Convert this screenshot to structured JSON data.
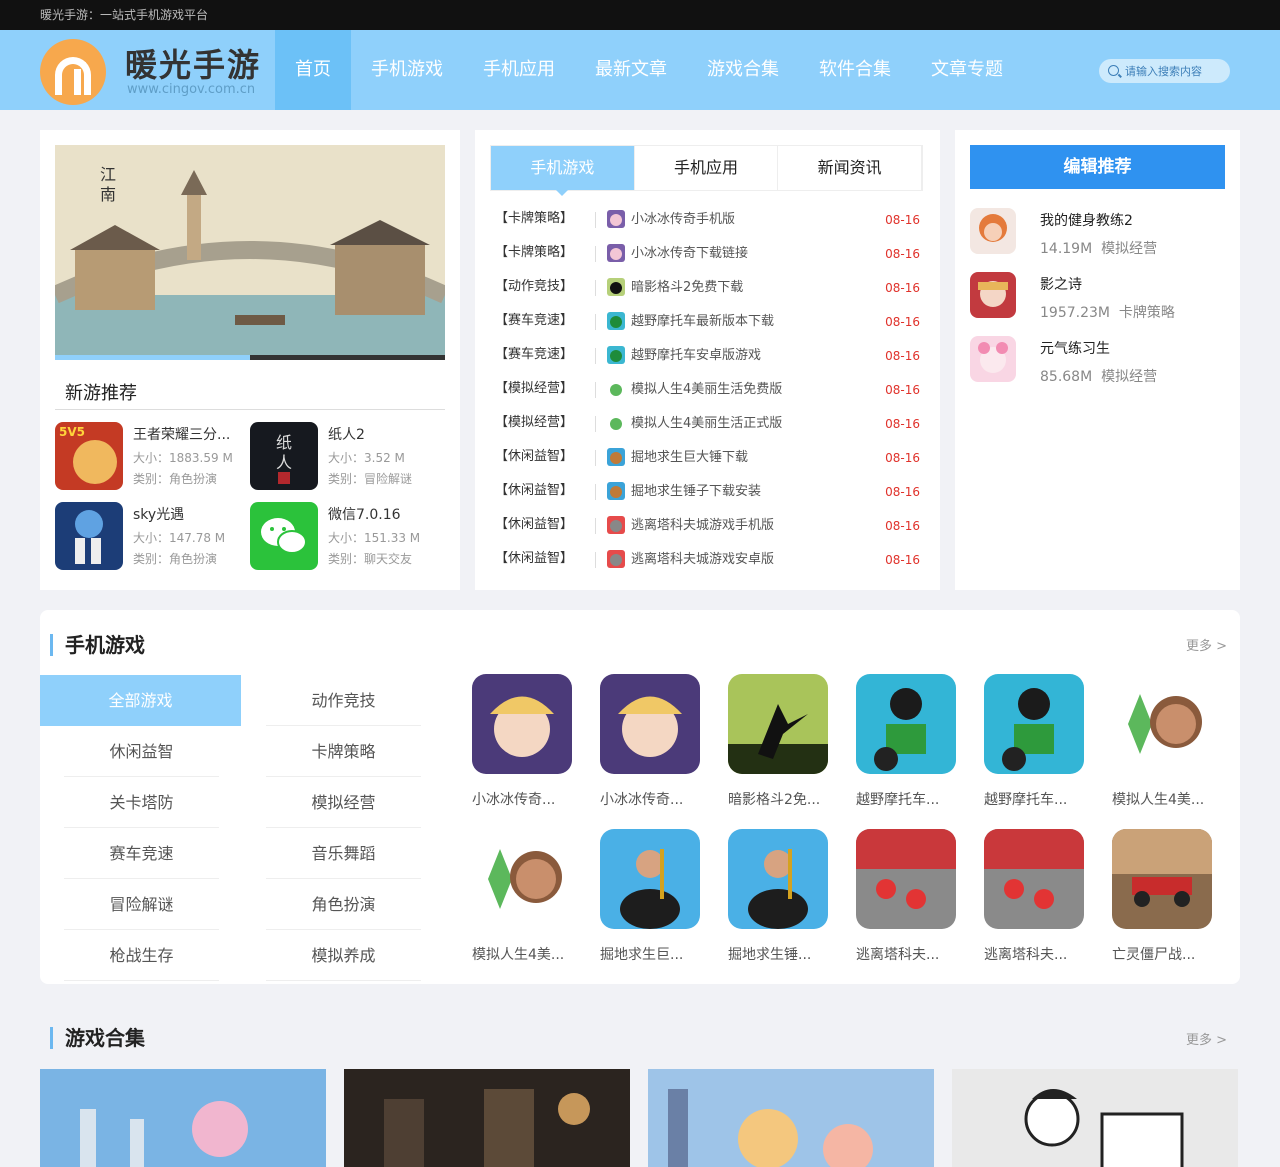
{
  "topbar": {
    "text": "暖光手游：一站式手机游戏平台"
  },
  "header": {
    "logo_title": "暖光手游",
    "logo_sub": "www.cingov.com.cn",
    "nav": [
      "首页",
      "手机游戏",
      "手机应用",
      "最新文章",
      "游戏合集",
      "软件合集",
      "文章专题"
    ],
    "search_placeholder": "请输入搜索内容"
  },
  "left_panel": {
    "banner_progress": 0.5,
    "section_title": "新游推荐",
    "items": [
      {
        "name": "王者荣耀三分...",
        "size": "大小：1883.59 M",
        "cat": "类别：角色扮演"
      },
      {
        "name": "纸人2",
        "size": "大小：3.52 M",
        "cat": "类别：冒险解谜"
      },
      {
        "name": "sky光遇",
        "size": "大小：147.78 M",
        "cat": "类别：角色扮演"
      },
      {
        "name": "微信7.0.16",
        "size": "大小：151.33 M",
        "cat": "类别：聊天交友"
      }
    ]
  },
  "middle_panel": {
    "tabs": [
      "手机游戏",
      "手机应用",
      "新闻资讯"
    ],
    "news": [
      {
        "cat": "【卡牌策略】",
        "title": "小冰冰传奇手机版",
        "date": "08-16"
      },
      {
        "cat": "【卡牌策略】",
        "title": "小冰冰传奇下载链接",
        "date": "08-16"
      },
      {
        "cat": "【动作竞技】",
        "title": "暗影格斗2免费下载",
        "date": "08-16"
      },
      {
        "cat": "【赛车竞速】",
        "title": "越野摩托车最新版本下载",
        "date": "08-16"
      },
      {
        "cat": "【赛车竞速】",
        "title": "越野摩托车安卓版游戏",
        "date": "08-16"
      },
      {
        "cat": "【模拟经营】",
        "title": "模拟人生4美丽生活免费版",
        "date": "08-16"
      },
      {
        "cat": "【模拟经营】",
        "title": "模拟人生4美丽生活正式版",
        "date": "08-16"
      },
      {
        "cat": "【休闲益智】",
        "title": "掘地求生巨大锤下载",
        "date": "08-16"
      },
      {
        "cat": "【休闲益智】",
        "title": "掘地求生锤子下载安装",
        "date": "08-16"
      },
      {
        "cat": "【休闲益智】",
        "title": "逃离塔科夫城游戏手机版",
        "date": "08-16"
      },
      {
        "cat": "【休闲益智】",
        "title": "逃离塔科夫城游戏安卓版",
        "date": "08-16"
      }
    ]
  },
  "editor_panel": {
    "title": "编辑推荐",
    "items": [
      {
        "name": "我的健身教练2",
        "size": "14.19M",
        "cat": "模拟经营"
      },
      {
        "name": "影之诗",
        "size": "1957.23M",
        "cat": "卡牌策略"
      },
      {
        "name": "元气练习生",
        "size": "85.68M",
        "cat": "模拟经营"
      }
    ]
  },
  "mobile_games": {
    "title": "手机游戏",
    "more": "更多 >",
    "categories_left": [
      "全部游戏",
      "休闲益智",
      "关卡塔防",
      "赛车竞速",
      "冒险解谜",
      "枪战生存"
    ],
    "categories_right": [
      "动作竞技",
      "卡牌策略",
      "模拟经营",
      "音乐舞蹈",
      "角色扮演",
      "模拟养成"
    ],
    "games": [
      "小冰冰传奇...",
      "小冰冰传奇...",
      "暗影格斗2免...",
      "越野摩托车...",
      "越野摩托车...",
      "模拟人生4美...",
      "模拟人生4美...",
      "掘地求生巨...",
      "掘地求生锤...",
      "逃离塔科夫...",
      "逃离塔科夫...",
      "亡灵僵尸战..."
    ]
  },
  "collections": {
    "title": "游戏合集",
    "more": "更多 >"
  }
}
